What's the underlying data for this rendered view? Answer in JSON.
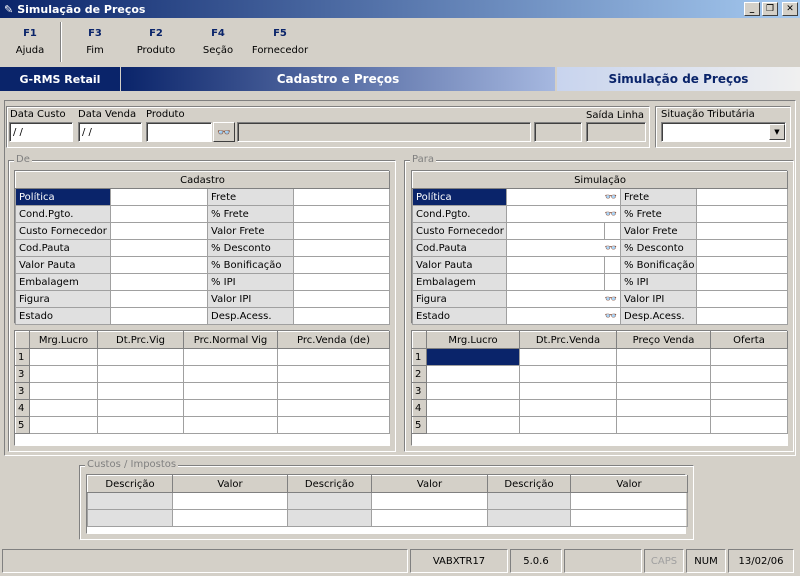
{
  "window": {
    "title": "Simulação de Preços"
  },
  "toolbar": {
    "keys": [
      {
        "key": "F1",
        "label": "Ajuda"
      },
      {
        "key": "F3",
        "label": "Fim"
      },
      {
        "key": "F2",
        "label": "Produto"
      },
      {
        "key": "F4",
        "label": "Seção"
      },
      {
        "key": "F5",
        "label": "Fornecedor"
      }
    ]
  },
  "header": {
    "brand": "G-RMS Retail",
    "section": "Cadastro e Preços",
    "screen": "Simulação de Preços"
  },
  "search": {
    "data_custo_label": "Data Custo",
    "data_custo_value": " / /",
    "data_venda_label": "Data Venda",
    "data_venda_value": " / /",
    "produto_label": "Produto",
    "produto_value": "",
    "saida_linha_label": "Saída Linha",
    "situacao_label": "Situação Tributária",
    "situacao_value": ""
  },
  "de": {
    "group_label": "De",
    "cadastro_header": "Cadastro",
    "rows": [
      {
        "left": "Política",
        "right": "Frete"
      },
      {
        "left": "Cond.Pgto.",
        "right": "% Frete"
      },
      {
        "left": "Custo Fornecedor",
        "right": "Valor Frete"
      },
      {
        "left": "Cod.Pauta",
        "right": "% Desconto"
      },
      {
        "left": "Valor Pauta",
        "right": "% Bonificação"
      },
      {
        "left": "Embalagem",
        "right": "% IPI"
      },
      {
        "left": "Figura",
        "right": "Valor IPI"
      },
      {
        "left": "Estado",
        "right": "Desp.Acess."
      }
    ],
    "margin_columns": [
      "Mrg.Lucro",
      "Dt.Prc.Vig",
      "Prc.Normal Vig",
      "Prc.Venda (de)"
    ],
    "margin_rows": [
      "1",
      "3",
      "3",
      "4",
      "5"
    ]
  },
  "para": {
    "group_label": "Para",
    "simulacao_header": "Simulação",
    "rows": [
      {
        "left": "Política",
        "right": "Frete"
      },
      {
        "left": "Cond.Pgto.",
        "right": "% Frete"
      },
      {
        "left": "Custo Fornecedor",
        "right": "Valor Frete"
      },
      {
        "left": "Cod.Pauta",
        "right": "% Desconto"
      },
      {
        "left": "Valor Pauta",
        "right": "% Bonificação"
      },
      {
        "left": "Embalagem",
        "right": "% IPI"
      },
      {
        "left": "Figura",
        "right": "Valor IPI"
      },
      {
        "left": "Estado",
        "right": "Desp.Acess."
      }
    ],
    "margin_columns": [
      "Mrg.Lucro",
      "Dt.Prc.Venda",
      "Preço Venda",
      "Oferta"
    ],
    "margin_rows": [
      "1",
      "2",
      "3",
      "4",
      "5"
    ]
  },
  "custos": {
    "group_label": "Custos / Impostos",
    "columns": [
      "Descrição",
      "Valor",
      "Descrição",
      "Valor",
      "Descrição",
      "Valor"
    ]
  },
  "statusbar": {
    "program": "VABXTR17",
    "version": "5.0.6",
    "caps": "CAPS",
    "num": "NUM",
    "date": "13/02/06"
  },
  "colors": {
    "selection": "#0a246a",
    "face": "#d4d0c8"
  }
}
